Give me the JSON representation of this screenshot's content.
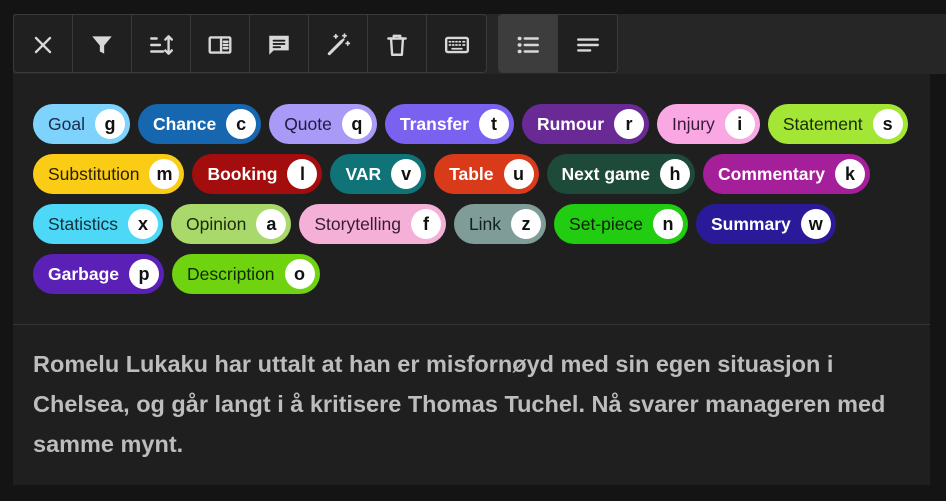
{
  "toolbar": {
    "groups": [
      [
        {
          "icon": "close-icon"
        },
        {
          "icon": "filter-icon"
        },
        {
          "icon": "sort-icon"
        },
        {
          "icon": "sidebar-panel-icon"
        },
        {
          "icon": "comment-icon"
        },
        {
          "icon": "magic-wand-icon"
        },
        {
          "icon": "trash-icon"
        },
        {
          "icon": "keyboard-icon"
        }
      ],
      [
        {
          "icon": "list-view-icon",
          "active": true
        },
        {
          "icon": "text-view-icon",
          "active": false
        }
      ]
    ]
  },
  "tags": [
    {
      "label": "Goal",
      "key": "g",
      "bg": "#7dd3fc",
      "fg": "#1e2a4a"
    },
    {
      "label": "Chance",
      "key": "c",
      "bg": "#1666b0",
      "fg": "#ffffff"
    },
    {
      "label": "Quote",
      "key": "q",
      "bg": "#a99af7",
      "fg": "#1c1c40"
    },
    {
      "label": "Transfer",
      "key": "t",
      "bg": "#7b61f0",
      "fg": "#ffffff"
    },
    {
      "label": "Rumour",
      "key": "r",
      "bg": "#6a2a96",
      "fg": "#ffffff"
    },
    {
      "label": "Injury",
      "key": "i",
      "bg": "#f9a8e4",
      "fg": "#3a1a3a"
    },
    {
      "label": "Statement",
      "key": "s",
      "bg": "#a3e635",
      "fg": "#1a2a0a"
    },
    {
      "label": "Substitution",
      "key": "m",
      "bg": "#facc15",
      "fg": "#2a2000"
    },
    {
      "label": "Booking",
      "key": "l",
      "bg": "#a30d0d",
      "fg": "#ffffff"
    },
    {
      "label": "VAR",
      "key": "v",
      "bg": "#0f7378",
      "fg": "#ffffff"
    },
    {
      "label": "Table",
      "key": "u",
      "bg": "#d93a1a",
      "fg": "#ffffff"
    },
    {
      "label": "Next game",
      "key": "h",
      "bg": "#1e4a3a",
      "fg": "#ffffff"
    },
    {
      "label": "Commentary",
      "key": "k",
      "bg": "#a61f9a",
      "fg": "#ffffff"
    },
    {
      "label": "Statistics",
      "key": "x",
      "bg": "#4dd8f7",
      "fg": "#10303a"
    },
    {
      "label": "Opinion",
      "key": "a",
      "bg": "#a8d96a",
      "fg": "#1a2a0a"
    },
    {
      "label": "Storytelling",
      "key": "f",
      "bg": "#f5b0d8",
      "fg": "#3a1a30"
    },
    {
      "label": "Link",
      "key": "z",
      "bg": "#7f9c99",
      "fg": "#14201f"
    },
    {
      "label": "Set-piece",
      "key": "n",
      "bg": "#22cc10",
      "fg": "#0a200a"
    },
    {
      "label": "Summary",
      "key": "w",
      "bg": "#2a1a9a",
      "fg": "#ffffff"
    },
    {
      "label": "Garbage",
      "key": "p",
      "bg": "#5b21b6",
      "fg": "#ffffff"
    },
    {
      "label": "Description",
      "key": "o",
      "bg": "#6fd40f",
      "fg": "#102a00"
    }
  ],
  "content": {
    "text": "Romelu Lukaku har uttalt at han er misfornøyd med sin egen situasjon i Chelsea, og går langt i å kritisere Thomas Tuchel. Nå svarer manageren med samme mynt."
  }
}
